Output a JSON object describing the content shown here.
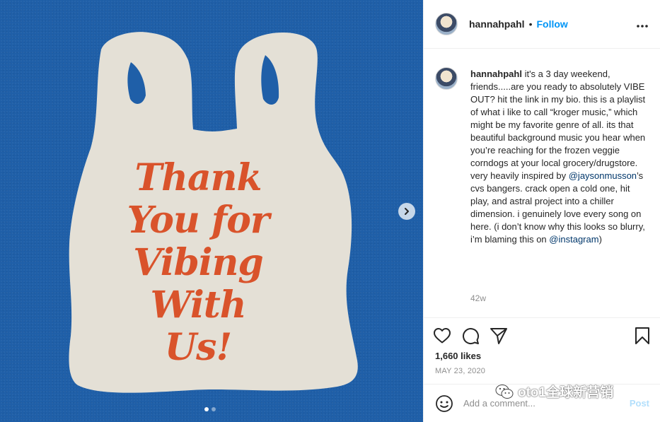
{
  "post": {
    "image_text": [
      "Thank",
      "You for",
      "Vibing",
      "With",
      "Us!"
    ],
    "carousel_dots": 2
  },
  "header": {
    "username": "hannahpahl",
    "separator": "•",
    "follow_label": "Follow",
    "more_label": "..."
  },
  "caption": {
    "username": "hannahpahl",
    "text_before": " it's a 3 day weekend, friends.....are you ready to absolutely VIBE OUT? hit the link in my bio. this is a playlist of what i like to call “kroger music,” which might be my favorite genre of all. its that beautiful background music you hear when you’re reaching for the frozen veggie corndogs at your local grocery/drugstore. very heavily inspired by ",
    "mention1": "@jaysonmusson",
    "text_middle": "’s cvs bangers. crack open a cold one, hit play, and astral project into a chiller dimension. i genuinely love every song on here. (i don’t know why this looks so blurry, i’m blaming this on ",
    "mention2": "@instagram",
    "text_after": ")",
    "time_ago": "42w"
  },
  "stats": {
    "likes": "1,660 likes",
    "date": "MAY 23, 2020"
  },
  "comment": {
    "placeholder": "Add a comment...",
    "post_label": "Post"
  },
  "watermark": {
    "text": "oto1全球新营销"
  },
  "colors": {
    "media_bg": "#1f5fa8",
    "bag": "#e4e0d6",
    "bag_text": "#d9532b",
    "link": "#0095f6",
    "post_disabled": "#b2dffc"
  }
}
